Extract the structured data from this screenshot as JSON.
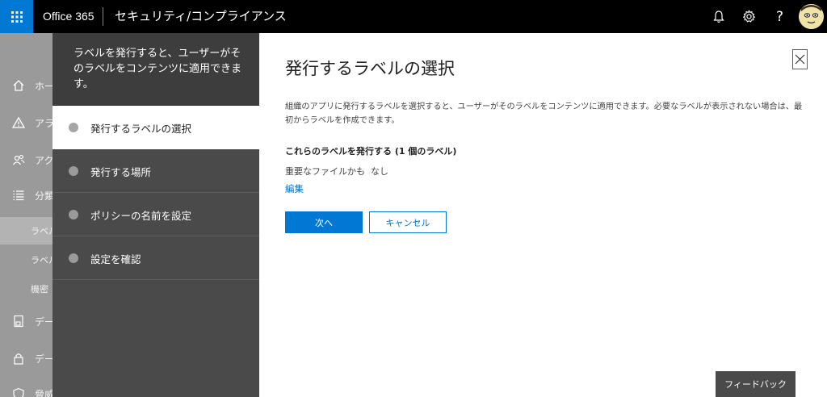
{
  "topbar": {
    "app_name": "Office 365",
    "section_title": "セキュリティ/コンプライアンス",
    "icons": [
      "waffle-icon",
      "bell-icon",
      "gear-icon",
      "help-icon",
      "avatar"
    ]
  },
  "leftnav": {
    "items": [
      {
        "icon": "home-icon",
        "label": "ホーム"
      },
      {
        "icon": "alert-icon",
        "label": "アラート"
      },
      {
        "icon": "people-icon",
        "label": "アクセス許可"
      },
      {
        "icon": "list-icon",
        "label": "分類"
      }
    ],
    "sub_items": [
      {
        "label": "ラベル",
        "active": true
      },
      {
        "label": "ラベル"
      },
      {
        "label": "機密"
      }
    ],
    "items_bottom": [
      {
        "icon": "device-icon",
        "label": "データ"
      },
      {
        "icon": "lock-icon",
        "label": "データ"
      },
      {
        "icon": "threat-icon",
        "label": "脅威"
      }
    ]
  },
  "wizard": {
    "header": "ラベルを発行すると、ユーザーがそのラベルをコンテンツに適用できます。",
    "steps": [
      {
        "label": "発行するラベルの選択",
        "active": true
      },
      {
        "label": "発行する場所"
      },
      {
        "label": "ポリシーの名前を設定"
      },
      {
        "label": "設定を確認"
      }
    ]
  },
  "main": {
    "title": "発行するラベルの選択",
    "description": "組織のアプリに発行するラベルを選択すると、ユーザーがそのラベルをコンテンツに適用できます。必要なラベルが表示されない場合は、最初からラベルを作成できます。",
    "section_heading": "これらのラベルを発行する (1 個のラベル)",
    "label_name": "重要なファイルかも",
    "label_value": "なし",
    "edit_link": "編集",
    "next_button": "次へ",
    "cancel_button": "キャンセル",
    "feedback_button": "フィードバック"
  },
  "colors": {
    "accent": "#0078d4",
    "topbar": "#000000",
    "wizard_bg": "#4a4a4a"
  }
}
